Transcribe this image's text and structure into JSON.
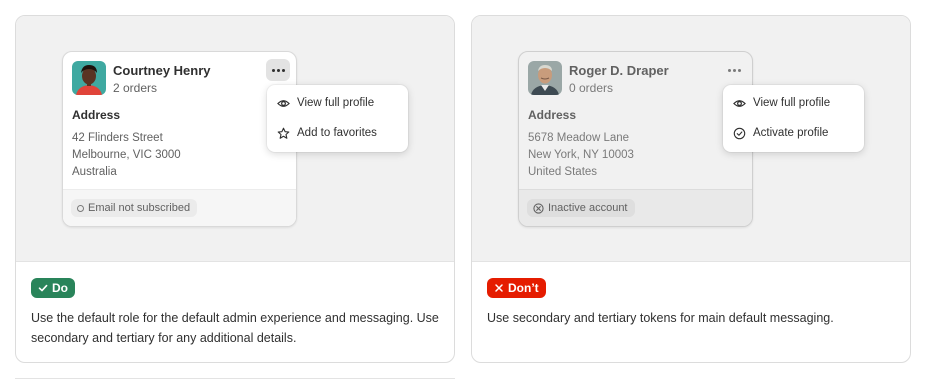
{
  "do_example": {
    "customer": {
      "name": "Courtney Henry",
      "orders": "2 orders",
      "address_heading": "Address",
      "address_lines": [
        "42 Flinders Street",
        "Melbourne, VIC 3000",
        "Australia"
      ],
      "status_badge": "Email not subscribed"
    },
    "menu": [
      {
        "label": "View full profile",
        "icon": "eye-icon"
      },
      {
        "label": "Add to favorites",
        "icon": "star-icon"
      }
    ],
    "verdict": {
      "label": "Do",
      "icon": "checkmark-icon",
      "color": "#29845a"
    },
    "caption": "Use the default role for the default admin experience and messaging. Use secondary and tertiary for any additional details."
  },
  "dont_example": {
    "customer": {
      "name": "Roger D. Draper",
      "orders": "0 orders",
      "address_heading": "Address",
      "address_lines": [
        "5678 Meadow Lane",
        "New York, NY 10003",
        "United States"
      ],
      "status_badge": "Inactive account"
    },
    "menu": [
      {
        "label": "View full profile",
        "icon": "eye-icon"
      },
      {
        "label": "Activate profile",
        "icon": "check-circle-icon"
      }
    ],
    "verdict": {
      "label": "Don’t",
      "icon": "x-icon",
      "color": "#e51c00"
    },
    "caption": "Use secondary and tertiary tokens for main default messaging."
  }
}
